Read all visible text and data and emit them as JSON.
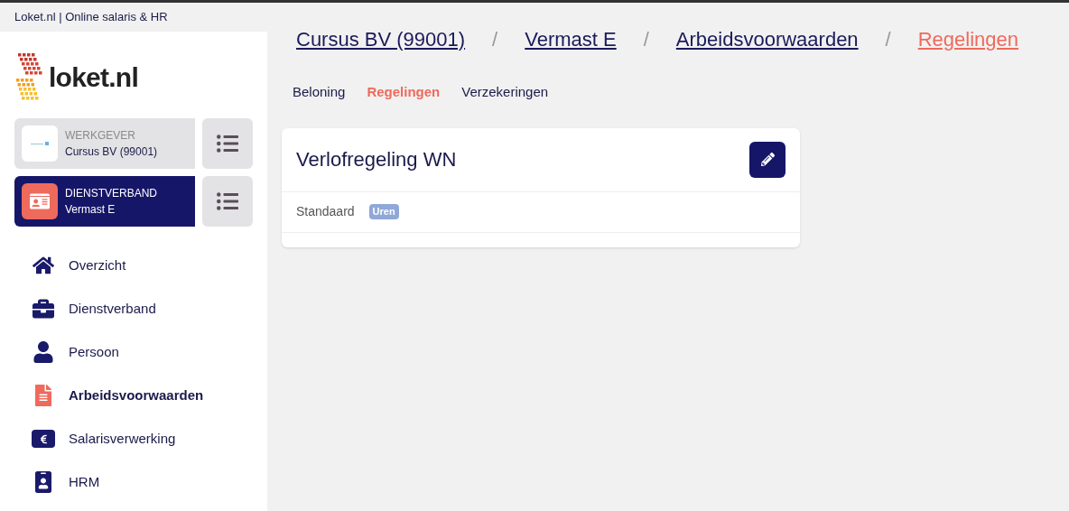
{
  "top_bar": {
    "title": "Loket.nl | Online salaris & HR"
  },
  "logo": {
    "text": "loket.nl"
  },
  "context_cards": [
    {
      "kind": "employer",
      "label": "WERKGEVER",
      "value": "Cursus BV (99001)",
      "selected": false
    },
    {
      "kind": "employment",
      "label": "DIENSTVERBAND",
      "value": "Vermast E",
      "selected": true
    }
  ],
  "nav": [
    {
      "kind": "home",
      "label": "Overzicht",
      "selected": false
    },
    {
      "kind": "briefcase",
      "label": "Dienstverband",
      "selected": false
    },
    {
      "kind": "person",
      "label": "Persoon",
      "selected": false
    },
    {
      "kind": "document",
      "label": "Arbeidsvoorwaarden",
      "selected": true
    },
    {
      "kind": "money",
      "label": "Salarisverwerking",
      "selected": false
    },
    {
      "kind": "hrm",
      "label": "HRM",
      "selected": false
    }
  ],
  "breadcrumbs": [
    {
      "label": "Cursus BV (99001)",
      "selected": false
    },
    {
      "label": "Vermast E",
      "selected": false
    },
    {
      "label": "Arbeidsvoorwaarden",
      "selected": false
    },
    {
      "label": "Regelingen",
      "selected": true
    }
  ],
  "separator": "/",
  "tabs": [
    {
      "label": "Beloning",
      "selected": false
    },
    {
      "label": "Regelingen",
      "selected": true
    },
    {
      "label": "Verzekeringen",
      "selected": false
    }
  ],
  "card": {
    "title": "Verlofregeling WN",
    "rows": [
      {
        "label": "Standaard",
        "badge": "Uren"
      }
    ]
  }
}
